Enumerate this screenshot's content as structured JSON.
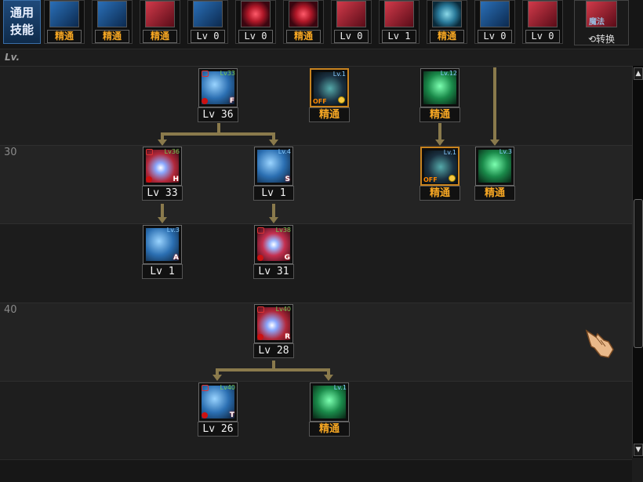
{
  "top_bar": {
    "general_tab": "通用\n技能",
    "slots": [
      {
        "icon": "athlete-blue-icon",
        "label": "精通",
        "mastered": true
      },
      {
        "icon": "dragon-blue-icon",
        "label": "精通",
        "mastered": true
      },
      {
        "icon": "fighter-red-icon",
        "label": "精通",
        "mastered": true
      },
      {
        "icon": "wings-blue-icon",
        "label": "Lv 0",
        "mastered": false
      },
      {
        "icon": "target-red-icon",
        "label": "Lv 0",
        "mastered": false
      },
      {
        "icon": "target-red-icon",
        "label": "精通",
        "mastered": true
      },
      {
        "icon": "demon-red-icon",
        "label": "Lv 0",
        "mastered": false
      },
      {
        "icon": "kneel-red-icon",
        "label": "Lv 1",
        "mastered": false
      },
      {
        "icon": "eye-teal-icon",
        "label": "精通",
        "mastered": true
      },
      {
        "icon": "armor-blue-icon",
        "label": "Lv 0",
        "mastered": false
      },
      {
        "icon": "beast-red-icon",
        "label": "Lv 0",
        "mastered": false
      }
    ],
    "switch_tab": {
      "icon_text": "魔法",
      "label": "⟲转换"
    }
  },
  "tree": {
    "lv_header": "Lv.",
    "row_labels": [
      "30",
      "40"
    ],
    "nodes": [
      {
        "id": "n1",
        "level_label": "Lv 36",
        "req": "Lv33",
        "key": "F",
        "locked": true,
        "mastered": false,
        "style": "a-blue"
      },
      {
        "id": "n2",
        "level_label": "精通",
        "req": "Lv.1",
        "key": "",
        "locked": false,
        "mastered": true,
        "off": "OFF",
        "style": "a-dark"
      },
      {
        "id": "n3",
        "level_label": "精通",
        "req": "Lv.12",
        "key": "",
        "locked": false,
        "mastered": true,
        "style": "a-green"
      },
      {
        "id": "n4",
        "level_label": "Lv 33",
        "req": "Lv36",
        "key": "H",
        "locked": true,
        "mastered": false,
        "style": "a-red"
      },
      {
        "id": "n5",
        "level_label": "Lv 1",
        "req": "Lv.4",
        "key": "S",
        "locked": false,
        "mastered": false,
        "style": "a-blue"
      },
      {
        "id": "n6",
        "level_label": "精通",
        "req": "Lv.1",
        "key": "",
        "locked": false,
        "mastered": true,
        "off": "OFF",
        "style": "a-dark"
      },
      {
        "id": "n7",
        "level_label": "精通",
        "req": "Lv.3",
        "key": "",
        "locked": false,
        "mastered": true,
        "style": "a-green"
      },
      {
        "id": "n8",
        "level_label": "Lv 1",
        "req": "Lv.3",
        "key": "A",
        "locked": false,
        "mastered": false,
        "style": "a-blue"
      },
      {
        "id": "n9",
        "level_label": "Lv 31",
        "req": "Lv38",
        "key": "G",
        "locked": true,
        "mastered": false,
        "style": "a-star"
      },
      {
        "id": "n10",
        "level_label": "Lv 28",
        "req": "Lv40",
        "key": "R",
        "locked": true,
        "mastered": false,
        "style": "a-red"
      },
      {
        "id": "n11",
        "level_label": "Lv 26",
        "req": "Lv40",
        "key": "T",
        "locked": true,
        "mastered": false,
        "style": "a-blue"
      },
      {
        "id": "n12",
        "level_label": "精通",
        "req": "Lv.1",
        "key": "",
        "locked": false,
        "mastered": true,
        "style": "a-green"
      }
    ]
  },
  "scrollbar": {
    "up": "▲",
    "down": "▼"
  }
}
